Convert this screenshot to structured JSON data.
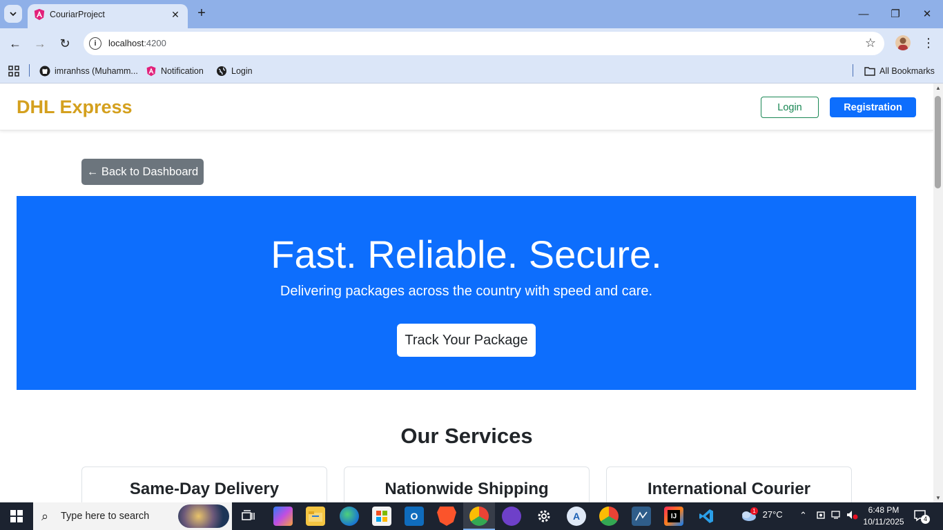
{
  "browser": {
    "tab_title": "CouriarProject",
    "url_host": "localhost",
    "url_port": ":4200",
    "bookmarks": [
      {
        "label": "imranhss (Muhamm...",
        "icon": "github-icon"
      },
      {
        "label": "Notification",
        "icon": "angular-icon"
      },
      {
        "label": "Login",
        "icon": "globe-icon"
      }
    ],
    "all_bookmarks": "All Bookmarks"
  },
  "navbar": {
    "brand": "DHL Express",
    "login_label": "Login",
    "registration_label": "Registration"
  },
  "main": {
    "back_label": "← Back to Dashboard",
    "hero": {
      "title": "Fast. Reliable. Secure.",
      "subtitle": "Delivering packages across the country with speed and care.",
      "cta": "Track Your Package"
    },
    "services_title": "Our Services",
    "services": [
      {
        "title": "Same-Day Delivery"
      },
      {
        "title": "Nationwide Shipping"
      },
      {
        "title": "International Courier"
      }
    ]
  },
  "taskbar": {
    "search_placeholder": "Type here to search",
    "weather": "27°C",
    "weather_badge": "1",
    "time": "6:48 PM",
    "date": "10/11/2025",
    "notification_count": "4"
  },
  "colors": {
    "brand": "#d4a01e",
    "primary": "#0d6efd",
    "success": "#198754",
    "secondary": "#6c757d"
  }
}
